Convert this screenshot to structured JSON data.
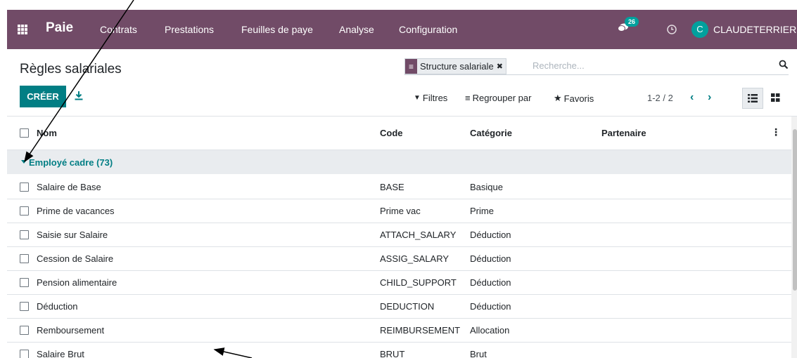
{
  "navbar": {
    "app_name": "Paie",
    "menu": [
      "Contrats",
      "Prestations",
      "Feuilles de paye",
      "Analyse",
      "Configuration"
    ],
    "chat_badge": "26",
    "avatar_letter": "C",
    "user_name": "CLAUDETERRIER"
  },
  "control_panel": {
    "title": "Règles salariales",
    "create_label": "CRÉER",
    "facet_label": "Structure salariale",
    "search_placeholder": "Recherche...",
    "filters_label": "Filtres",
    "group_by_label": "Regrouper par",
    "favorites_label": "Favoris",
    "pager": "1-2 / 2"
  },
  "table": {
    "headers": {
      "name": "Nom",
      "code": "Code",
      "category": "Catégorie",
      "partner": "Partenaire"
    },
    "group_label": "Employé cadre (73)",
    "rows": [
      {
        "name": "Salaire de Base",
        "code": "BASE",
        "category": "Basique"
      },
      {
        "name": "Prime de vacances",
        "code": "Prime vac",
        "category": "Prime"
      },
      {
        "name": "Saisie sur Salaire",
        "code": "ATTACH_SALARY",
        "category": "Déduction"
      },
      {
        "name": "Cession de Salaire",
        "code": "ASSIG_SALARY",
        "category": "Déduction"
      },
      {
        "name": "Pension alimentaire",
        "code": "CHILD_SUPPORT",
        "category": "Déduction"
      },
      {
        "name": "Déduction",
        "code": "DEDUCTION",
        "category": "Déduction"
      },
      {
        "name": "Remboursement",
        "code": "REIMBURSEMENT",
        "category": "Allocation"
      },
      {
        "name": "Salaire Brut",
        "code": "BRUT",
        "category": "Brut"
      }
    ]
  },
  "colors": {
    "navbar": "#714b67",
    "primary": "#017e84",
    "badge": "#00a09d"
  }
}
